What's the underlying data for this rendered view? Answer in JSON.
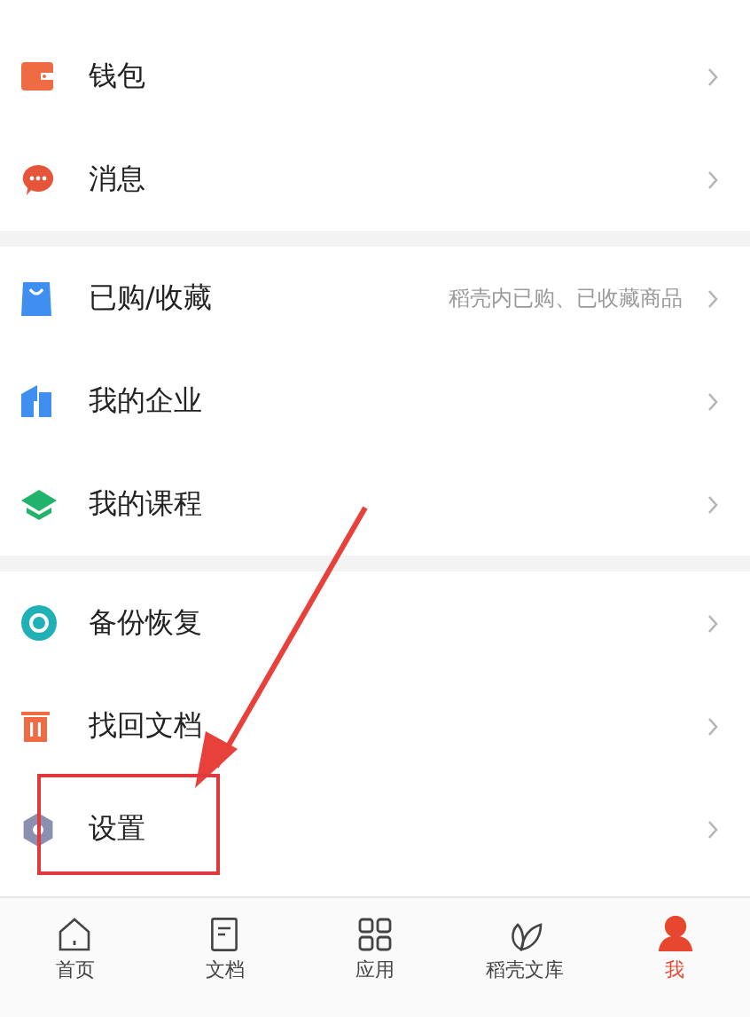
{
  "sections": [
    {
      "items": [
        {
          "label": "钱包"
        },
        {
          "label": "消息"
        }
      ]
    },
    {
      "items": [
        {
          "label": "已购/收藏",
          "hint": "稻壳内已购、已收藏商品"
        },
        {
          "label": "我的企业"
        },
        {
          "label": "我的课程"
        }
      ]
    },
    {
      "items": [
        {
          "label": "备份恢复"
        },
        {
          "label": "找回文档"
        },
        {
          "label": "设置"
        }
      ]
    }
  ],
  "tab_bar": [
    {
      "label": "首页",
      "selected": false
    },
    {
      "label": "文档",
      "selected": false
    },
    {
      "label": "应用",
      "selected": false
    },
    {
      "label": "稻壳文库",
      "selected": false
    },
    {
      "label": "我",
      "selected": true
    }
  ]
}
